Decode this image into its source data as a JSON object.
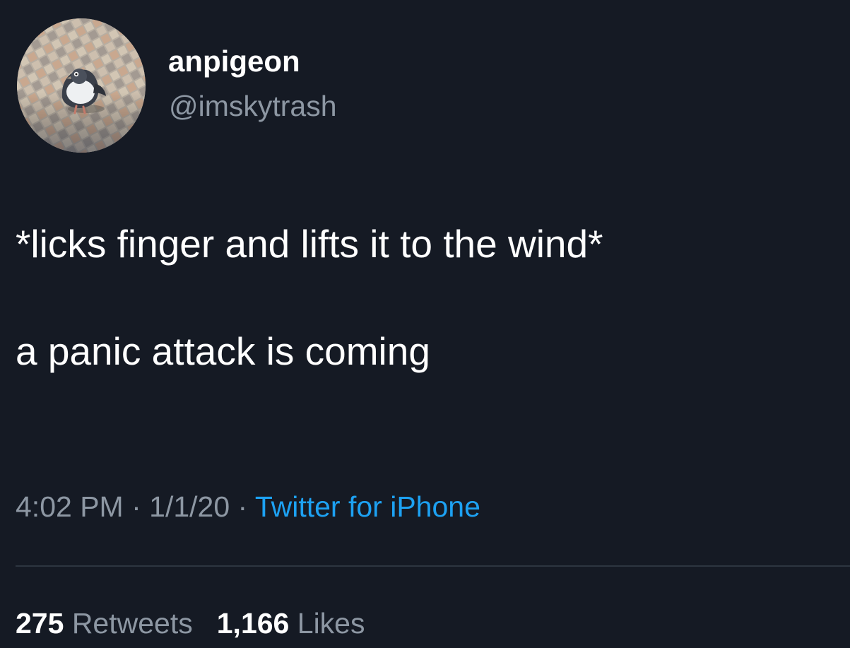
{
  "user": {
    "display_name": "anpigeon",
    "handle": "@imskytrash",
    "avatar_icon": "pigeon-avatar"
  },
  "tweet": {
    "line1": "*licks finger and lifts it to the wind*",
    "line2": "a panic attack is coming"
  },
  "meta": {
    "time": "4:02 PM",
    "separator": " · ",
    "date": "1/1/20",
    "source": "Twitter for iPhone"
  },
  "stats": {
    "retweets_count": "275",
    "retweets_label": "Retweets",
    "likes_count": "1,166",
    "likes_label": "Likes"
  },
  "colors": {
    "background": "#151a24",
    "primary_text": "#ffffff",
    "secondary_text": "#8d97a3",
    "link": "#1da1f2"
  }
}
